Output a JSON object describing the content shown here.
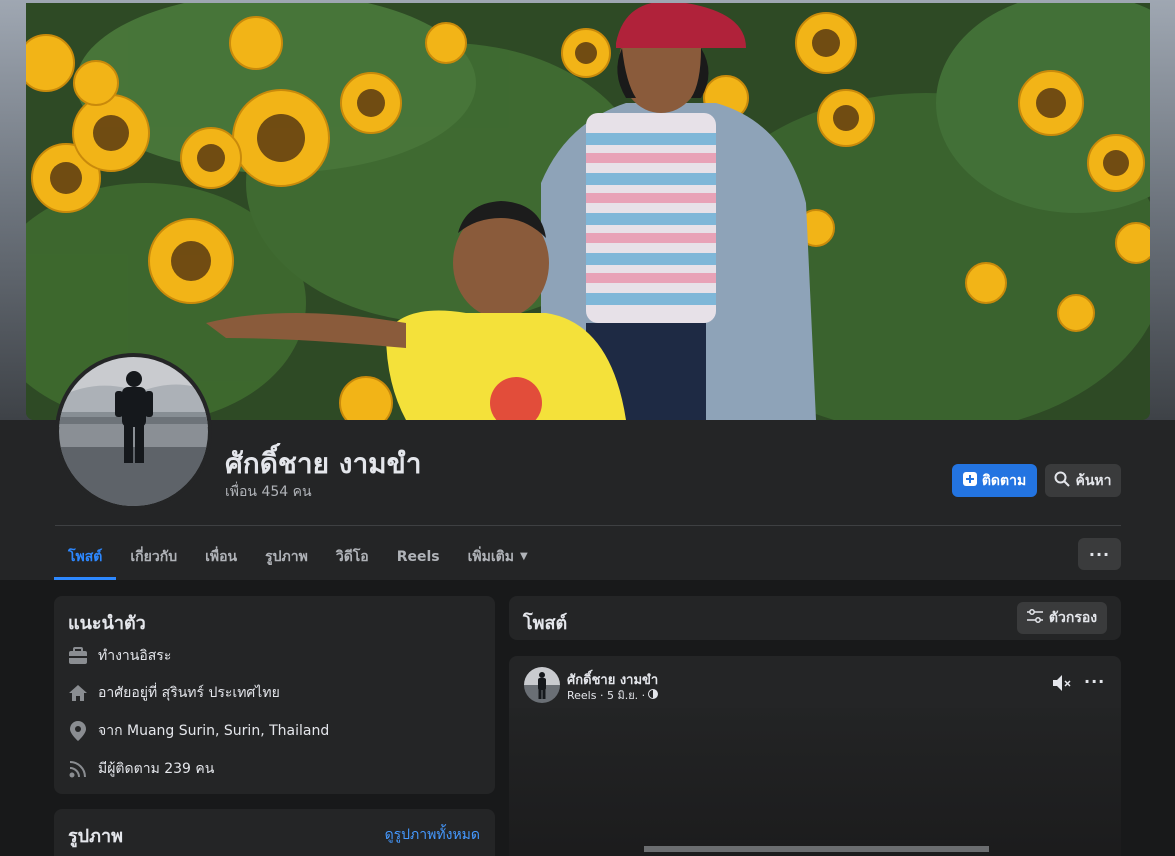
{
  "profile": {
    "name": "ศักดิ์ชาย งามขำ",
    "friends": "เพื่อน 454 คน"
  },
  "actions": {
    "follow_label": "ติดตาม",
    "search_label": "ค้นหา"
  },
  "tabs": [
    {
      "label": "โพสต์",
      "active": true
    },
    {
      "label": "เกี่ยวกับ"
    },
    {
      "label": "เพื่อน"
    },
    {
      "label": "รูปภาพ"
    },
    {
      "label": "วิดีโอ"
    },
    {
      "label": "Reels"
    },
    {
      "label": "เพิ่มเติม"
    }
  ],
  "intro": {
    "title": "แนะนำตัว",
    "items": [
      {
        "icon": "briefcase-icon",
        "text": "ทำงานอิสระ"
      },
      {
        "icon": "home-icon",
        "text": "อาศัยอยู่ที่ สุรินทร์ ประเทศไทย"
      },
      {
        "icon": "location-pin-icon",
        "text": "จาก Muang Surin, Surin, Thailand"
      },
      {
        "icon": "rss-icon",
        "text": "มีผู้ติดตาม 239 คน"
      }
    ]
  },
  "photos": {
    "title": "รูปภาพ",
    "see_all": "ดูรูปภาพทั้งหมด"
  },
  "posts": {
    "title": "โพสต์",
    "filter_label": "ตัวกรอง"
  },
  "post": {
    "author": "ศักดิ์ชาย งามขำ",
    "meta": "Reels · 5 มิ.ย. ·"
  },
  "colors": {
    "accent": "#2374e1",
    "tab_active": "#2d88ff",
    "link": "#4599ff",
    "card_bg": "#242526",
    "page_bg": "#18191a"
  }
}
